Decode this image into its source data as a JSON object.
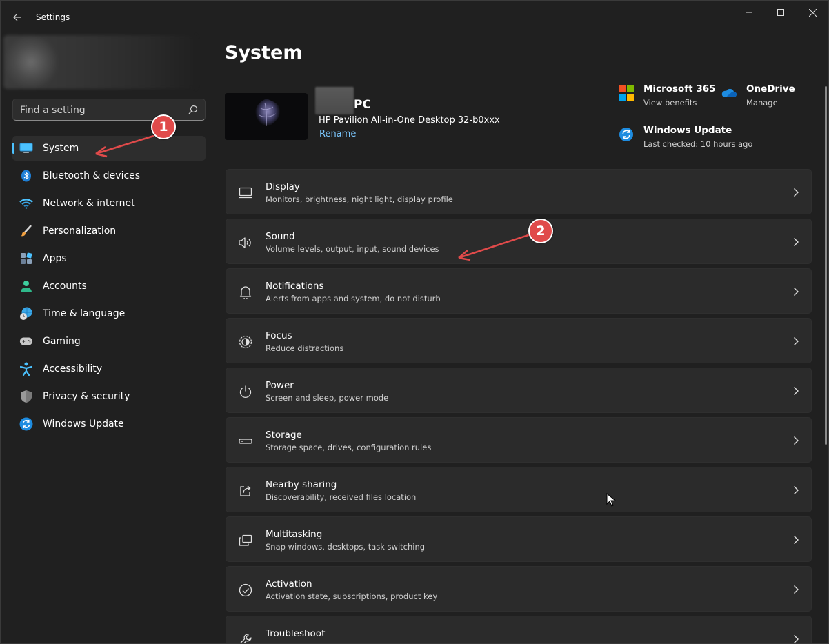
{
  "window": {
    "title": "Settings"
  },
  "search": {
    "placeholder": "Find a setting"
  },
  "sidebar": {
    "items": [
      {
        "label": "System",
        "icon": "system-display-icon",
        "active": true
      },
      {
        "label": "Bluetooth & devices",
        "icon": "bluetooth-icon"
      },
      {
        "label": "Network & internet",
        "icon": "wifi-icon"
      },
      {
        "label": "Personalization",
        "icon": "paintbrush-icon"
      },
      {
        "label": "Apps",
        "icon": "apps-grid-icon"
      },
      {
        "label": "Accounts",
        "icon": "person-icon"
      },
      {
        "label": "Time & language",
        "icon": "globe-clock-icon"
      },
      {
        "label": "Gaming",
        "icon": "gamepad-icon"
      },
      {
        "label": "Accessibility",
        "icon": "accessibility-icon"
      },
      {
        "label": "Privacy & security",
        "icon": "shield-icon"
      },
      {
        "label": "Windows Update",
        "icon": "sync-icon"
      }
    ]
  },
  "main": {
    "title": "System",
    "device": {
      "name_suffix": "PC",
      "model": "HP Pavilion All-in-One Desktop 32-b0xxx",
      "rename": "Rename"
    },
    "quick_links": [
      {
        "title": "Microsoft 365",
        "subtitle": "View benefits",
        "icon": "microsoft-365-icon"
      },
      {
        "title": "OneDrive",
        "subtitle": "Manage",
        "icon": "onedrive-cloud-icon"
      },
      {
        "title": "Windows Update",
        "subtitle": "Last checked: 10 hours ago",
        "icon": "windows-update-icon"
      }
    ],
    "cards": [
      {
        "title": "Display",
        "subtitle": "Monitors, brightness, night light, display profile",
        "icon": "monitor-icon"
      },
      {
        "title": "Sound",
        "subtitle": "Volume levels, output, input, sound devices",
        "icon": "speaker-icon"
      },
      {
        "title": "Notifications",
        "subtitle": "Alerts from apps and system, do not disturb",
        "icon": "bell-icon"
      },
      {
        "title": "Focus",
        "subtitle": "Reduce distractions",
        "icon": "focus-icon"
      },
      {
        "title": "Power",
        "subtitle": "Screen and sleep, power mode",
        "icon": "power-icon"
      },
      {
        "title": "Storage",
        "subtitle": "Storage space, drives, configuration rules",
        "icon": "storage-drive-icon"
      },
      {
        "title": "Nearby sharing",
        "subtitle": "Discoverability, received files location",
        "icon": "share-icon"
      },
      {
        "title": "Multitasking",
        "subtitle": "Snap windows, desktops, task switching",
        "icon": "multitasking-icon"
      },
      {
        "title": "Activation",
        "subtitle": "Activation state, subscriptions, product key",
        "icon": "check-circle-icon"
      },
      {
        "title": "Troubleshoot",
        "subtitle": "",
        "icon": "wrench-icon"
      }
    ]
  },
  "annotations": {
    "badge1": "1",
    "badge2": "2",
    "color": "#e04a4a"
  },
  "colors": {
    "background": "#202020",
    "card": "#2b2b2b",
    "accent": "#4cc2ff",
    "link": "#7cc8ff"
  }
}
